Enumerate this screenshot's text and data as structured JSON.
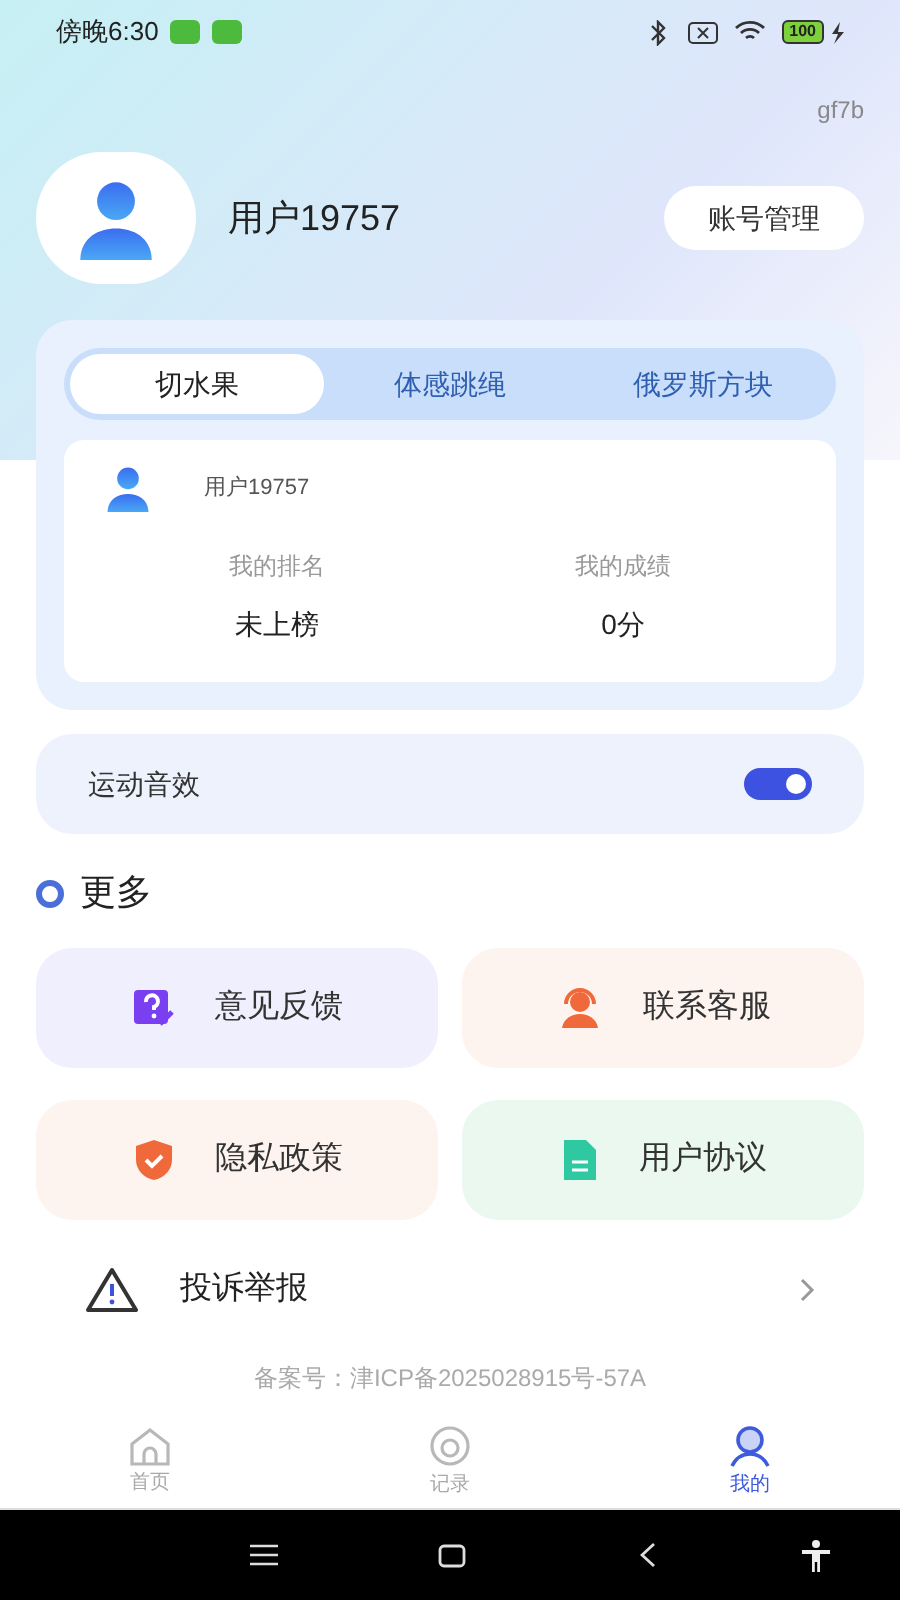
{
  "status_bar": {
    "time": "傍晚6:30",
    "battery": "100"
  },
  "code": "gf7b",
  "profile": {
    "name": "用户19757",
    "button": "账号管理"
  },
  "tabs": [
    {
      "label": "切水果",
      "selected": true
    },
    {
      "label": "体感跳绳",
      "selected": false
    },
    {
      "label": "俄罗斯方块",
      "selected": false
    }
  ],
  "rank_card": {
    "user": "用户19757",
    "stats": [
      {
        "label": "我的排名",
        "value": "未上榜"
      },
      {
        "label": "我的成绩",
        "value": "0分"
      }
    ]
  },
  "sound_setting": {
    "label": "运动音效",
    "on": true
  },
  "more": {
    "title": "更多",
    "tiles": [
      {
        "label": "意见反馈",
        "kind": "feedback",
        "color": "#f0effd"
      },
      {
        "label": "联系客服",
        "kind": "service",
        "color": "#fdf3ef"
      },
      {
        "label": "隐私政策",
        "kind": "privacy",
        "color": "#fdf3ef"
      },
      {
        "label": "用户协议",
        "kind": "agreement",
        "color": "#eaf8f0"
      }
    ]
  },
  "report": {
    "label": "投诉举报"
  },
  "icp": "备案号：津ICP备2025028915号-57A",
  "nav": [
    {
      "label": "首页",
      "kind": "home",
      "selected": false
    },
    {
      "label": "记录",
      "kind": "record",
      "selected": false
    },
    {
      "label": "我的",
      "kind": "me",
      "selected": true
    }
  ]
}
